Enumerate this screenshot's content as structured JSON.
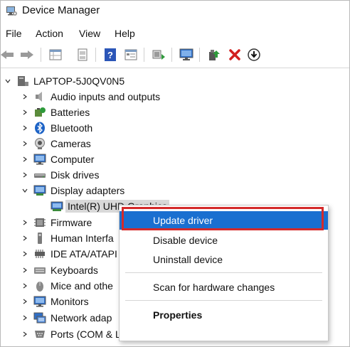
{
  "window": {
    "title": "Device Manager"
  },
  "menu": [
    "File",
    "Action",
    "View",
    "Help"
  ],
  "toolbar": [
    "back-icon",
    "forward-icon",
    "properties-grid-icon",
    "document-icon",
    "help-icon",
    "details-icon",
    "scan-hardware-icon",
    "monitor-icon",
    "add-driver-icon",
    "remove-x-icon",
    "download-circle-icon"
  ],
  "tree": {
    "root": "LAPTOP-5J0QV0N5",
    "items": [
      {
        "label": "Audio inputs and outputs",
        "icon": "speaker-icon"
      },
      {
        "label": "Batteries",
        "icon": "battery-icon"
      },
      {
        "label": "Bluetooth",
        "icon": "bluetooth-icon"
      },
      {
        "label": "Cameras",
        "icon": "camera-icon"
      },
      {
        "label": "Computer",
        "icon": "computer-icon"
      },
      {
        "label": "Disk drives",
        "icon": "disk-drive-icon"
      },
      {
        "label": "Display adapters",
        "icon": "display-adapter-icon",
        "expanded": true
      },
      {
        "label": "Intel(R) UHD Graphics",
        "icon": "display-adapter-icon",
        "child": true,
        "selected": true
      },
      {
        "label": "Firmware",
        "icon": "firmware-icon"
      },
      {
        "label": "Human Interfa",
        "icon": "hid-icon"
      },
      {
        "label": "IDE ATA/ATAPI c",
        "icon": "ide-controller-icon"
      },
      {
        "label": "Keyboards",
        "icon": "keyboard-icon"
      },
      {
        "label": "Mice and othe",
        "icon": "mouse-icon"
      },
      {
        "label": "Monitors",
        "icon": "monitor-icon"
      },
      {
        "label": "Network adap",
        "icon": "network-icon"
      },
      {
        "label": "Ports (COM & LPT)",
        "icon": "port-icon"
      }
    ]
  },
  "context_menu": {
    "items": [
      {
        "label": "Update driver",
        "highlighted": true
      },
      {
        "label": "Disable device"
      },
      {
        "label": "Uninstall device"
      },
      {
        "label": "Scan for hardware changes"
      },
      {
        "label": "Properties",
        "bold": true
      }
    ]
  },
  "colors": {
    "highlight": "#1a6fd0",
    "annotation": "#d42a2a",
    "selection": "#d9d9d9"
  }
}
